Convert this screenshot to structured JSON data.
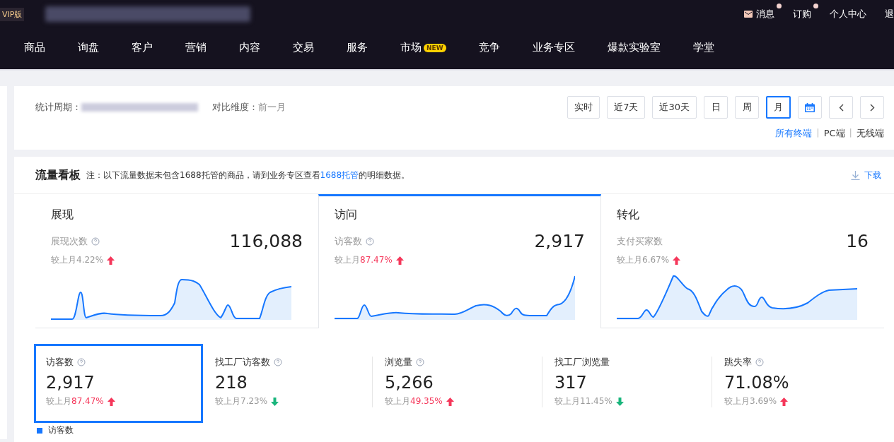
{
  "header": {
    "badge": "VIP版",
    "top_links": [
      {
        "label": "消息",
        "dot": true
      },
      {
        "label": "订购",
        "dot": true
      },
      {
        "label": "个人中心",
        "dot": false
      },
      {
        "label": "退",
        "dot": false
      }
    ],
    "nav": [
      {
        "label": "商品"
      },
      {
        "label": "询盘"
      },
      {
        "label": "客户"
      },
      {
        "label": "营销"
      },
      {
        "label": "内容"
      },
      {
        "label": "交易"
      },
      {
        "label": "服务"
      },
      {
        "label": "市场",
        "badge": "NEW"
      },
      {
        "label": "竞争"
      },
      {
        "label": "业务专区"
      },
      {
        "label": "爆款实验室"
      },
      {
        "label": "学堂"
      }
    ]
  },
  "filter": {
    "period_label": "统计周期：",
    "compare_label": "对比维度：",
    "compare_value": "前一月",
    "ranges": [
      {
        "label": "实时",
        "selected": false
      },
      {
        "label": "近7天",
        "selected": false
      },
      {
        "label": "近30天",
        "selected": false
      },
      {
        "label": "日",
        "selected": false
      },
      {
        "label": "周",
        "selected": false
      },
      {
        "label": "月",
        "selected": true
      }
    ],
    "terminals": [
      {
        "label": "所有终端",
        "selected": true
      },
      {
        "label": "PC端",
        "selected": false
      },
      {
        "label": "无线端",
        "selected": false
      }
    ],
    "separators": [
      "|",
      "|"
    ]
  },
  "board": {
    "title": "流量看板",
    "note_before": "注：以下流量数据未包含1688托管的商品，请到业务专区查看",
    "note_link": "1688托管",
    "note_after": "的明细数据。",
    "download": "下载",
    "tabs": [
      {
        "title": "展现",
        "metric": "展现次数",
        "value": "116,088",
        "delta_prefix": "较上月",
        "delta": "4.22%",
        "kind": "rise",
        "highlight": false,
        "selected": false
      },
      {
        "title": "访问",
        "metric": "访客数",
        "value": "2,917",
        "delta_prefix": "较上月",
        "delta": "87.47%",
        "kind": "rise",
        "highlight": true,
        "selected": true
      },
      {
        "title": "转化",
        "metric": "支付买家数",
        "value": "16",
        "delta_prefix": "较上月",
        "delta": "6.67%",
        "kind": "rise",
        "highlight": false,
        "selected": false
      }
    ],
    "metrics": [
      {
        "label": "访客数",
        "help": true,
        "value": "2,917",
        "delta_prefix": "较上月",
        "delta": "87.47%",
        "kind": "rise",
        "highlight": true,
        "selected": true
      },
      {
        "label": "找工厂访客数",
        "help": true,
        "value": "218",
        "delta_prefix": "较上月",
        "delta": "7.23%",
        "kind": "fall",
        "highlight": false,
        "selected": false
      },
      {
        "label": "浏览量",
        "help": true,
        "value": "5,266",
        "delta_prefix": "较上月",
        "delta": "49.35%",
        "kind": "rise",
        "highlight": true,
        "selected": false
      },
      {
        "label": "找工厂浏览量",
        "help": false,
        "value": "317",
        "delta_prefix": "较上月",
        "delta": "11.45%",
        "kind": "fall",
        "highlight": false,
        "selected": false
      },
      {
        "label": "跳失率",
        "help": true,
        "value": "71.08%",
        "delta_prefix": "较上月",
        "delta": "3.69%",
        "kind": "rise",
        "highlight": false,
        "selected": false
      }
    ],
    "legend": "访客数"
  }
}
